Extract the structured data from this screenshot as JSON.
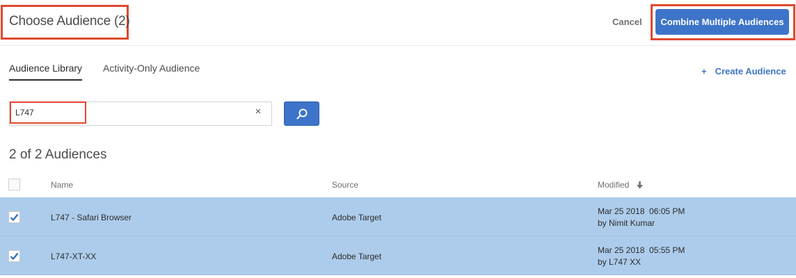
{
  "header": {
    "title": "Choose Audience (2)",
    "cancel_label": "Cancel",
    "combine_label": "Combine Multiple Audiences"
  },
  "tabs": [
    {
      "label": "Audience Library",
      "active": true
    },
    {
      "label": "Activity-Only Audience",
      "active": false
    }
  ],
  "create": {
    "plus": "+",
    "label": "Create Audience"
  },
  "search": {
    "value": "L747",
    "clear_icon": "×"
  },
  "result_count": "2 of 2 Audiences",
  "table": {
    "columns": {
      "name": "Name",
      "source": "Source",
      "modified": "Modified"
    },
    "rows": [
      {
        "checked": true,
        "name": "L747 - Safari Browser",
        "source": "Adobe Target",
        "modified_date": "Mar 25 2018  06:05 PM",
        "modified_by": "by Nimit Kumar"
      },
      {
        "checked": true,
        "name": "L747-XT-XX",
        "source": "Adobe Target",
        "modified_date": "Mar 25 2018  05:55 PM",
        "modified_by": "by L747 XX"
      }
    ]
  },
  "colors": {
    "accent": "#3d74c9",
    "highlight_border": "#e0482f",
    "selected_row": "#adcceb"
  }
}
